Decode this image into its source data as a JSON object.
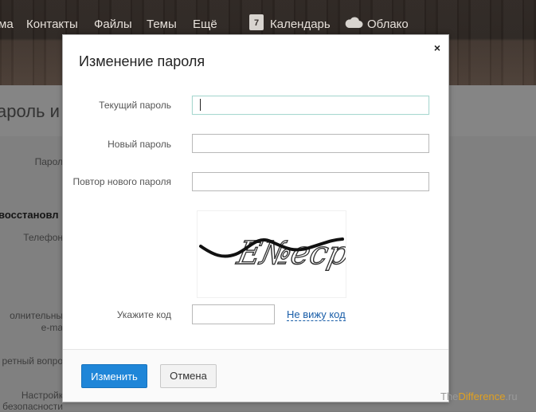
{
  "topnav": {
    "items": [
      "ма",
      "Контакты",
      "Файлы",
      "Темы",
      "Ещё"
    ],
    "calendar_icon_day": "7",
    "calendar": "Календарь",
    "cloud": "Облако"
  },
  "background": {
    "title": "ароль и",
    "labels": [
      "Парол",
      "восстановл",
      "Телефон",
      "олнительны",
      "e-ma",
      "ретный вопро",
      "Настройк",
      "безопасности"
    ]
  },
  "modal": {
    "title": "Изменение пароля",
    "close_label": "×",
    "fields": [
      {
        "label": "Текущий пароль",
        "value": ""
      },
      {
        "label": "Новый пароль",
        "value": ""
      },
      {
        "label": "Повтор нового пароля",
        "value": ""
      }
    ],
    "captcha_text": "Е№еср",
    "code_label": "Укажите код",
    "code_value": "",
    "cant_see_link": "Не вижу код",
    "submit_label": "Изменить",
    "cancel_label": "Отмена"
  },
  "watermark": {
    "brand_a": "The",
    "brand_b": "Difference",
    "brand_c": ".ru"
  },
  "colors": {
    "primary_button": "#1f86d8",
    "link": "#1a5ea8",
    "overlay": "#808080"
  }
}
